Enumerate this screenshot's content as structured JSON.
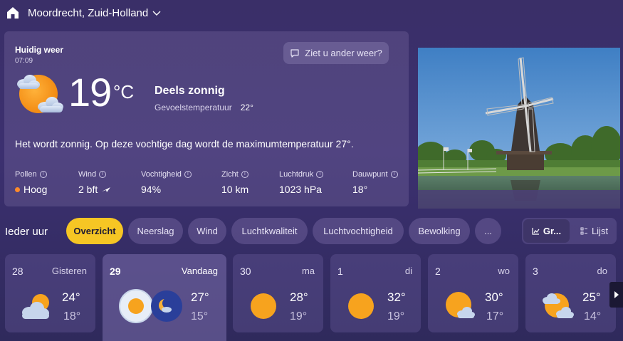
{
  "header": {
    "location": "Moordrecht, Zuid-Holland",
    "icons": {
      "home": "home-icon",
      "dropdown": "chevron-down-icon"
    }
  },
  "current": {
    "title": "Huidig weer",
    "time": "07:09",
    "feedback_label": "Ziet u ander weer?",
    "temperature": "19",
    "unit": "°C",
    "condition": "Deels zonnig",
    "feels_label": "Gevoelstemperatuur",
    "feels_value": "22°",
    "summary": "Het wordt zonnig. Op deze vochtige dag wordt de maximumtemperatuur 27°.",
    "icon": "partly-sunny-icon",
    "metrics": [
      {
        "label": "Pollen",
        "value": "Hoog",
        "indicator_color": "#ff8a2a"
      },
      {
        "label": "Wind",
        "value": "2 bft"
      },
      {
        "label": "Vochtigheid",
        "value": "94%"
      },
      {
        "label": "Zicht",
        "value": "10 km"
      },
      {
        "label": "Luchtdruk",
        "value": "1023 hPa"
      },
      {
        "label": "Dauwpunt",
        "value": "18°"
      }
    ]
  },
  "forecast": {
    "section_label": "Ieder uur",
    "tabs": [
      "Overzicht",
      "Neerslag",
      "Wind",
      "Luchtkwaliteit",
      "Luchtvochtigheid",
      "Bewolking",
      "..."
    ],
    "active_tab": "Overzicht",
    "views": [
      "Gr...",
      "Lijst"
    ],
    "days": [
      {
        "num": "28",
        "label": "Gisteren",
        "hi": "24°",
        "lo": "18°",
        "icon": "partly-cloudy-icon"
      },
      {
        "num": "29",
        "label": "Vandaag",
        "hi": "27°",
        "lo": "15°",
        "icon": "sun-and-moon-icon"
      },
      {
        "num": "30",
        "label": "ma",
        "hi": "28°",
        "lo": "19°",
        "icon": "sunny-icon"
      },
      {
        "num": "1",
        "label": "di",
        "hi": "32°",
        "lo": "19°",
        "icon": "sunny-icon"
      },
      {
        "num": "2",
        "label": "wo",
        "hi": "30°",
        "lo": "17°",
        "icon": "mostly-sunny-icon"
      },
      {
        "num": "3",
        "label": "do",
        "hi": "25°",
        "lo": "14°",
        "icon": "partly-cloudy-icon"
      }
    ]
  },
  "colors": {
    "accent": "#f6c624",
    "sun": "#f7a31e",
    "background": "#3a2f68"
  }
}
